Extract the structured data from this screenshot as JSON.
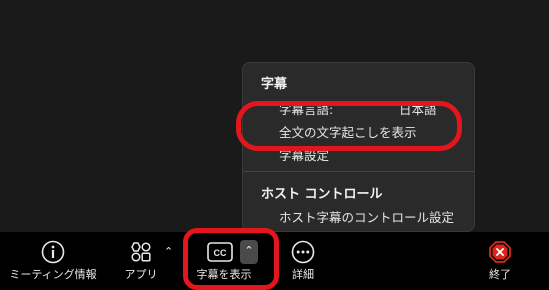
{
  "menu": {
    "captions_heading": "字幕",
    "caption_language_label": "字幕言語:",
    "caption_language_value": "日本語",
    "full_transcript": "全文の文字起こしを表示",
    "caption_settings": "字幕設定",
    "host_heading": "ホスト コントロール",
    "host_caption_control": "ホスト字幕のコントロール設定"
  },
  "toolbar": {
    "meeting_info": "ミーティング情報",
    "apps": "アプリ",
    "show_captions": "字幕を表示",
    "details": "詳細",
    "end": "終了"
  },
  "colors": {
    "annotation_red": "#e3161e",
    "end_red": "#d7281e",
    "toolbar_bg": "#000000",
    "menu_bg": "#2a2a2a"
  }
}
